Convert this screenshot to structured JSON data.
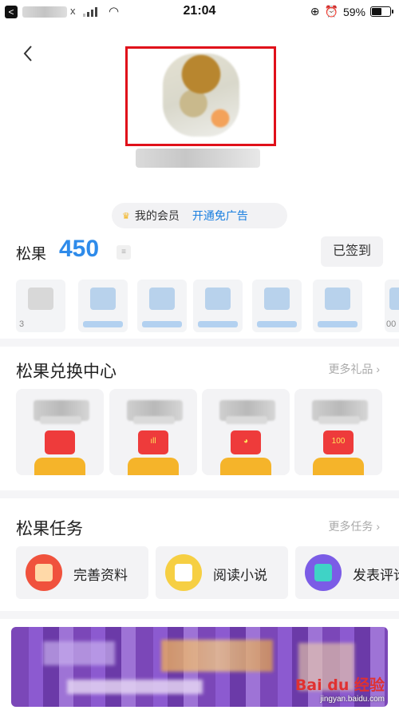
{
  "status_bar": {
    "time": "21:04",
    "battery": "59%",
    "battery_level": 0.59,
    "back_glyph": "<",
    "carrier_icon": "x"
  },
  "header": {
    "back_icon": "chevron-left-icon"
  },
  "member": {
    "label": "我的会员",
    "link": "开通免广告"
  },
  "points": {
    "label": "松果",
    "value": "450",
    "checkin_label": "已签到"
  },
  "days": {
    "first_partial_text": "3",
    "last_partial_text": "00"
  },
  "exchange": {
    "title": "松果兑换中心",
    "more": "更多礼品",
    "gifts": [
      {
        "glyph": "",
        "box_color": "#ee3b3b"
      },
      {
        "glyph": "ıll",
        "box_color": "#ee3b3b"
      },
      {
        "glyph": "◕",
        "box_color": "#ee3b3b"
      },
      {
        "glyph": "100",
        "box_color": "#ee3b3b"
      }
    ]
  },
  "tasks": {
    "title": "松果任务",
    "more": "更多任务",
    "items": [
      {
        "label": "完善资料",
        "icon": "profile-icon",
        "color": "#f0523d"
      },
      {
        "label": "阅读小说",
        "icon": "book-icon",
        "color": "#f6cf43"
      },
      {
        "label": "发表评论",
        "icon": "comment-icon",
        "color": "#7b5ce6"
      }
    ]
  },
  "watermark": {
    "logo": "Bai du 经验",
    "url": "jingyan.baidu.com"
  },
  "colors": {
    "accent": "#2e8bea",
    "highlight_frame": "#e0101a"
  }
}
